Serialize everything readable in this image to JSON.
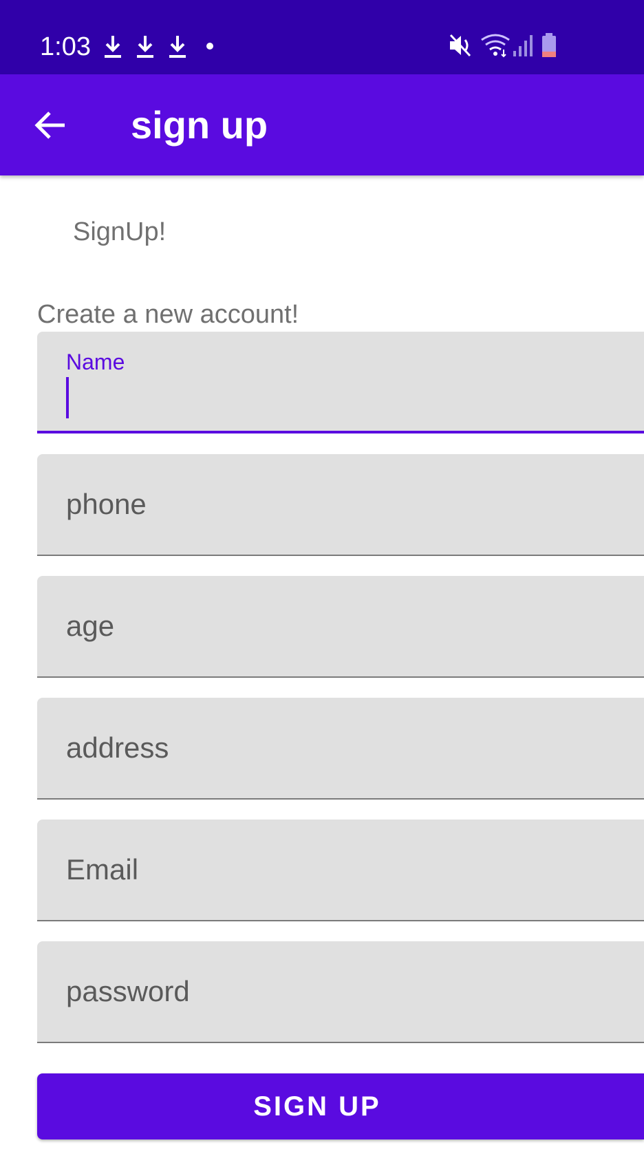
{
  "status_bar": {
    "time": "1:03",
    "icons": [
      "download-icon",
      "download-icon",
      "download-icon",
      "notification-dot",
      "mute-icon",
      "wifi-icon",
      "signal-icon",
      "battery-icon"
    ]
  },
  "app_bar": {
    "title": "sign up",
    "back_icon": "arrow-back-icon"
  },
  "content": {
    "heading": "SignUp!",
    "subheading": "Create a new account!"
  },
  "form": {
    "name": {
      "label": "Name",
      "value": ""
    },
    "phone": {
      "hint": "phone"
    },
    "age": {
      "hint": "age"
    },
    "address": {
      "hint": "address"
    },
    "email": {
      "hint": "Email"
    },
    "password": {
      "hint": "password"
    },
    "submit_label": "SIGN UP"
  },
  "colors": {
    "status_bar": "#3000a9",
    "primary": "#5a0be0",
    "field_bg": "#e0e0e0",
    "text_secondary": "#707070"
  }
}
